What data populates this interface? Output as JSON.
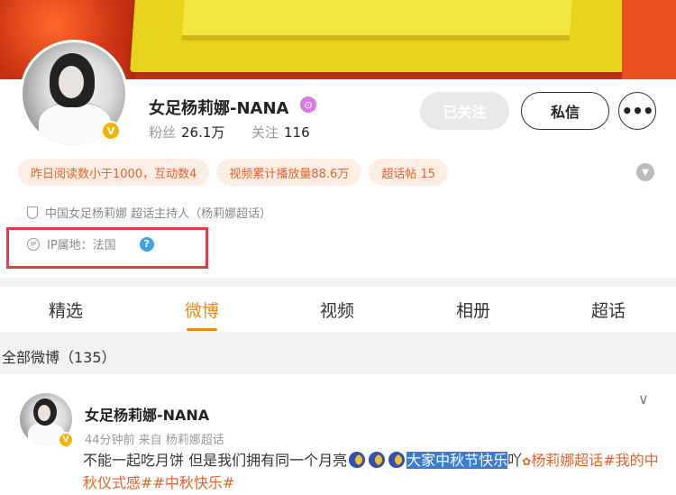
{
  "profile": {
    "name": "女足杨莉娜-NANA",
    "fans_label": "粉丝",
    "fans_value": "26.1万",
    "follow_label": "关注",
    "follow_value": "116",
    "btn_followed": "已关注",
    "btn_message": "私信",
    "btn_more": "•••",
    "verified_mark": "V",
    "tags": [
      "昨日阅读数小于1000，互动数4",
      "视频累计播放量88.6万",
      "超话帖 15"
    ],
    "desc": "中国女足杨莉娜 超话主持人（杨莉娜超话）",
    "ip_label": "IP属地：法国",
    "ip_icon": "IP",
    "help_mark": "?"
  },
  "tabs": [
    "精选",
    "微博",
    "视频",
    "相册",
    "超话"
  ],
  "active_tab": "微博",
  "feed": {
    "section_title": "全部微博（135）",
    "post": {
      "author": "女足杨莉娜-NANA",
      "meta": "44分钟前  来自 杨莉娜超话",
      "text_a": "不能一起吃月饼 但是我们拥有同一个月亮",
      "text_highlight": "大家中秋节快乐",
      "text_b": "吖",
      "topic_1": "杨莉娜超话",
      "topic_2": "#我的中秋仪式感#",
      "topic_3": "#中秋快乐#"
    }
  },
  "colors": {
    "accent": "#f08a0d",
    "tag_text": "#e8622c",
    "highlight": "#3a7bd5",
    "ip_box": "#e33b4a"
  }
}
